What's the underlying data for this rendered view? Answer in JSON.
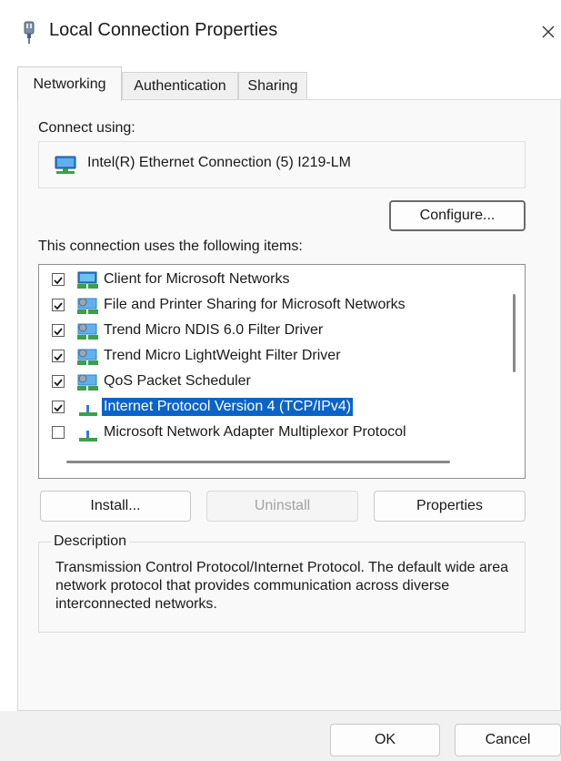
{
  "window": {
    "title": "Local Connection Properties",
    "close_glyph": "✕"
  },
  "tabs": [
    {
      "label": "Networking",
      "active": true
    },
    {
      "label": "Authentication",
      "active": false
    },
    {
      "label": "Sharing",
      "active": false
    }
  ],
  "networking": {
    "connect_using_label": "Connect using:",
    "adapter_name": "Intel(R) Ethernet Connection (5) I219-LM",
    "configure_label": "Configure...",
    "items_label": "This connection uses the following items:",
    "items": [
      {
        "label": "Client for Microsoft Networks",
        "checked": true,
        "icon": "network-client-icon",
        "selected": false
      },
      {
        "label": "File and Printer Sharing for Microsoft Networks",
        "checked": true,
        "icon": "network-service-icon",
        "selected": false
      },
      {
        "label": "Trend Micro NDIS 6.0 Filter Driver",
        "checked": true,
        "icon": "network-service-icon",
        "selected": false
      },
      {
        "label": "Trend Micro LightWeight Filter Driver",
        "checked": true,
        "icon": "network-service-icon",
        "selected": false
      },
      {
        "label": "QoS Packet Scheduler",
        "checked": true,
        "icon": "network-service-icon",
        "selected": false
      },
      {
        "label": "Internet Protocol Version 4 (TCP/IPv4)",
        "checked": true,
        "icon": "network-protocol-icon",
        "selected": true
      },
      {
        "label": "Microsoft Network Adapter Multiplexor Protocol",
        "checked": false,
        "icon": "network-protocol-icon",
        "selected": false
      }
    ],
    "install_label": "Install...",
    "uninstall_label": "Uninstall",
    "properties_label": "Properties",
    "description_legend": "Description",
    "description_text": "Transmission Control Protocol/Internet Protocol. The default wide area network protocol that provides communication across diverse interconnected networks."
  },
  "footer": {
    "ok_label": "OK",
    "cancel_label": "Cancel"
  },
  "colors": {
    "selection": "#0a64c8",
    "panel_bg": "#f9f9f9",
    "footer_bg": "#f1f1f1"
  }
}
